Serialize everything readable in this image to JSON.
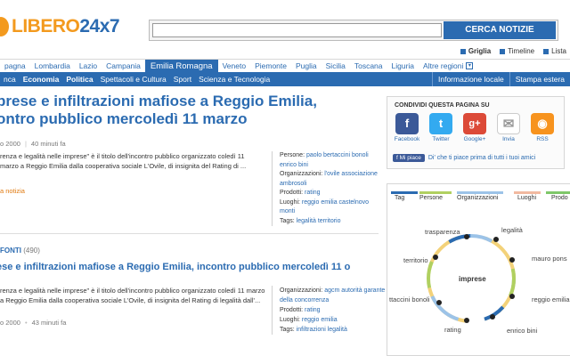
{
  "header": {
    "logo_text_a": "LIBERO",
    "logo_text_b": "24x7",
    "search_placeholder": "",
    "search_button": "CERCA NOTIZIE",
    "view_grid": "Griglia",
    "view_timeline": "Timeline",
    "view_list": "Lista"
  },
  "region_nav": {
    "items": [
      "pagna",
      "Lombardia",
      "Lazio",
      "Campania",
      "Emilia Romagna",
      "Veneto",
      "Piemonte",
      "Puglia",
      "Sicilia",
      "Toscana",
      "Liguria",
      "Altre regioni"
    ],
    "active": "Emilia Romagna"
  },
  "category_nav": {
    "items": [
      "nca",
      "Economia",
      "Politica",
      "Spettacoli e Cultura",
      "Sport",
      "Scienza e Tecnologia"
    ],
    "bold": [
      "Economia",
      "Politica"
    ],
    "right_items": [
      "Informazione locale",
      "Stampa estera"
    ]
  },
  "article": {
    "title_line1": "prese e infiltrazioni mafiose a Reggio Emilia,",
    "title_line2": "ontro pubblico mercoledì 11 marzo",
    "meta_date": "o 2000",
    "meta_time": "40 minuti fa",
    "abstract": "renza e legalità nelle imprese\" è il titolo dell'incontro pubblico organizzato coledì 11 marzo a Reggio Emilia dalla cooperativa sociale L'Ovile, di insignita del Rating di ...",
    "more_link": "a notizia",
    "tags": {
      "persone_label": "Persone:",
      "persone": "paolo bertaccini bonoli enrico bini",
      "organizzazioni_label": "Organizzazioni:",
      "organizzazioni": "l'ovile associazione ambrosoli",
      "prodotti_label": "Prodotti:",
      "prodotti": "rating",
      "luoghi_label": "Luoghi:",
      "luoghi": "reggio emilia castelnovo monti",
      "tags_label": "Tags:",
      "tags": "legalità territorio"
    }
  },
  "sources": {
    "label": "FONTI",
    "count": "(490)"
  },
  "article2": {
    "title": "ese e infiltrazioni mafiose a Reggio Emilia, incontro pubblico mercoledì 11 o",
    "abstract": "renza e legalità nelle imprese\" è il titolo dell'incontro pubblico organizzato coledì 11 marzo a Reggio Emilia dalla cooperativa sociale L'Ovile, di insignita del Rating di legalità dall'...",
    "meta_date": "o 2000",
    "meta_time": "43 minuti fa",
    "tags": {
      "organizzazioni_label": "Organizzazioni:",
      "organizzazioni": "agcm autorità garante della concorrenza",
      "prodotti_label": "Prodotti:",
      "prodotti": "rating",
      "luoghi_label": "Luoghi:",
      "luoghi": "reggio emilia",
      "tags_label": "Tags:",
      "tags": "infiltrazioni legalità"
    }
  },
  "share": {
    "title": "CONDIVIDI QUESTA PAGINA SU",
    "buttons": [
      {
        "label": "Facebook",
        "glyph": "f",
        "color": "#3b5998"
      },
      {
        "label": "Twitter",
        "glyph": "t",
        "color": "#33aaf0"
      },
      {
        "label": "Google+",
        "glyph": "g+",
        "color": "#dc4a38"
      },
      {
        "label": "Invia",
        "glyph": "✉",
        "color": "#ffffff"
      },
      {
        "label": "RSS",
        "glyph": "◉",
        "color": "#f7931e"
      }
    ],
    "like_button": "Mi piace",
    "like_text": "Di' che ti piace prima di tutti i tuoi amici"
  },
  "cloud": {
    "tabs": [
      {
        "label": "Tag",
        "color": "#2b6bb1"
      },
      {
        "label": "Persone",
        "color": "#b0d060"
      },
      {
        "label": "Organizzazioni",
        "color": "#9cc3e8"
      },
      {
        "label": "Luoghi",
        "color": "#f2b9a0"
      },
      {
        "label": "Prodo",
        "color": "#7fc76a"
      }
    ],
    "center": "imprese",
    "nodes": [
      "trasparenza",
      "legalità",
      "mauro pons",
      "reggio emilia",
      "enrico bini",
      "rating",
      "ttaccini bonoli",
      "territorio"
    ]
  }
}
